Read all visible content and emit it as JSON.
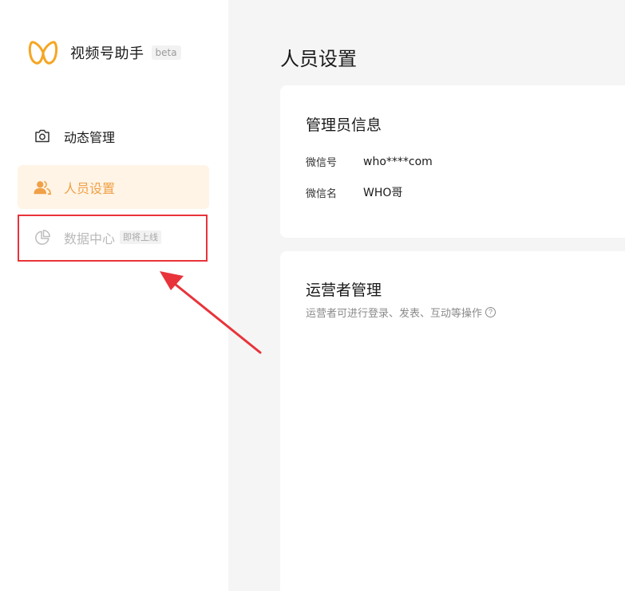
{
  "app": {
    "title": "视频号助手",
    "badge": "beta",
    "accent_color": "#f0a046"
  },
  "sidebar": {
    "items": [
      {
        "label": "动态管理",
        "icon": "camera-icon",
        "state": "normal"
      },
      {
        "label": "人员设置",
        "icon": "users-icon",
        "state": "active"
      },
      {
        "label": "数据中心",
        "icon": "pie-chart-icon",
        "state": "disabled",
        "badge": "即将上线"
      }
    ]
  },
  "main": {
    "title": "人员设置",
    "admin_card": {
      "title": "管理员信息",
      "rows": [
        {
          "key": "微信号",
          "value": "who****com"
        },
        {
          "key": "微信名",
          "value": "WHO哥"
        }
      ]
    },
    "ops_card": {
      "title": "运营者管理",
      "description": "运营者可进行登录、发表、互动等操作",
      "help_glyph": "?"
    }
  },
  "annotation": {
    "box_color": "#e8333a",
    "arrow_color": "#e8333a"
  }
}
